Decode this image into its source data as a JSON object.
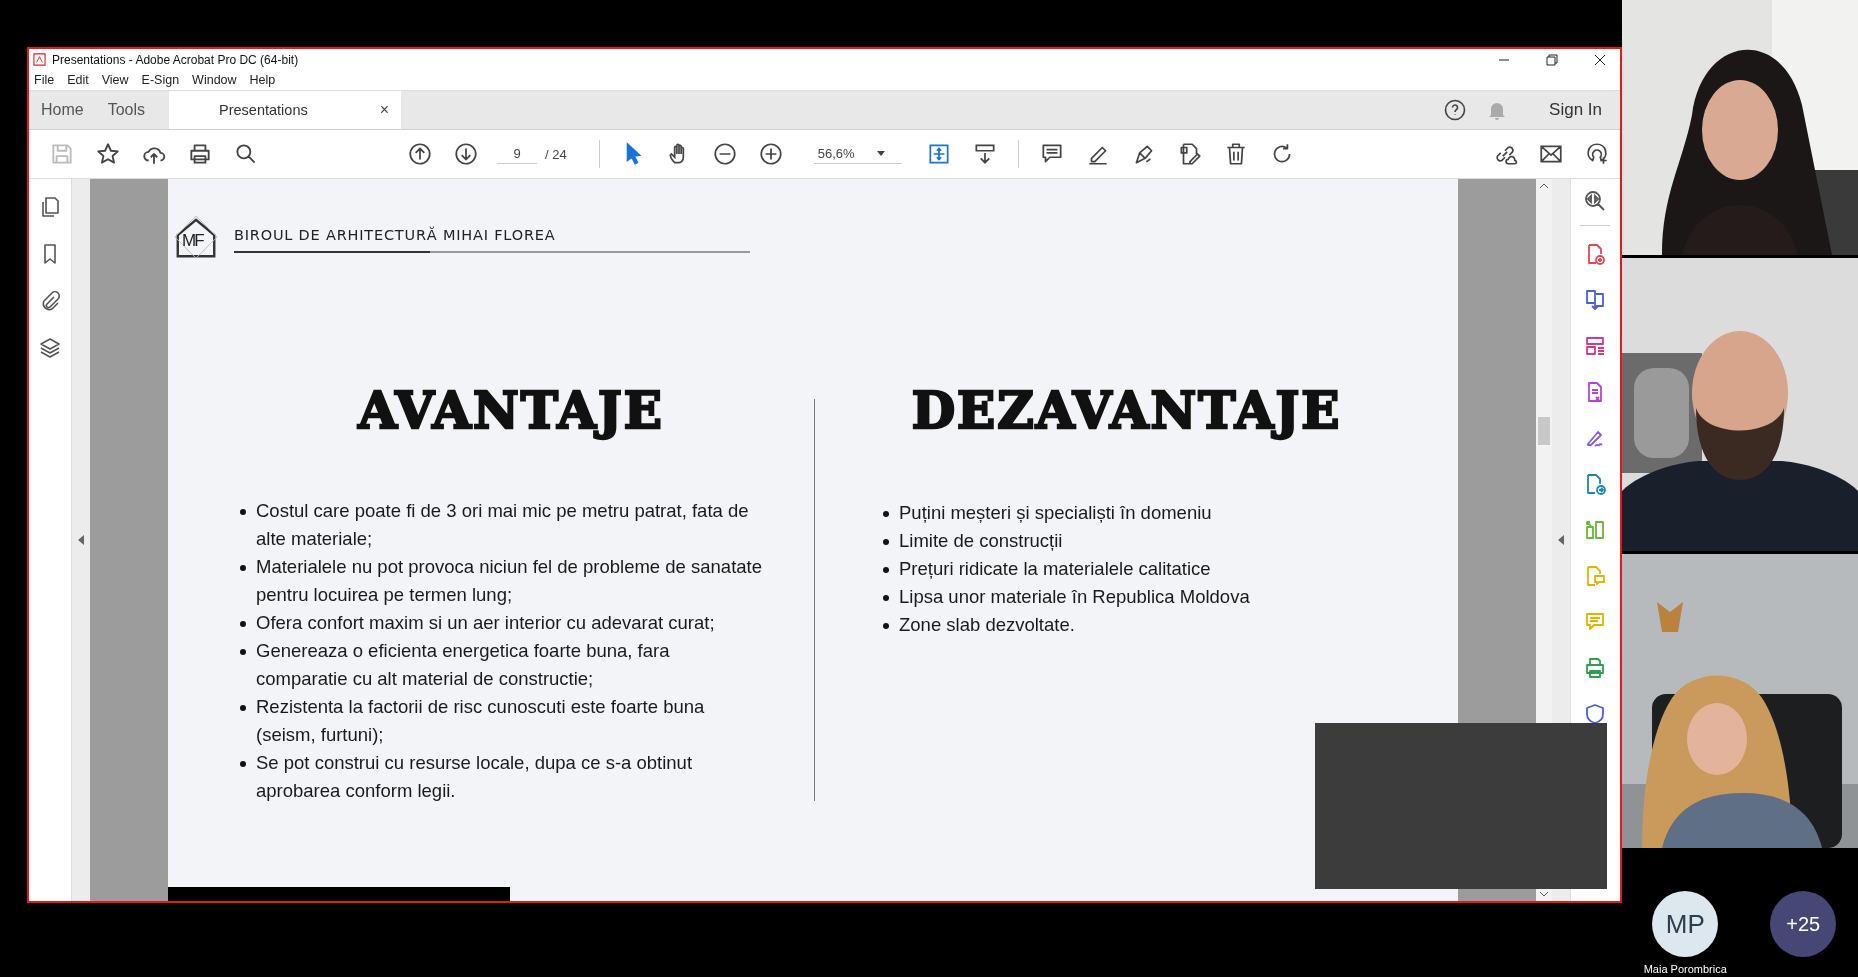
{
  "window": {
    "title": "Presentations - Adobe Acrobat Pro DC (64-bit)"
  },
  "menu": [
    "File",
    "Edit",
    "View",
    "E-Sign",
    "Window",
    "Help"
  ],
  "tabs": [
    {
      "label": "Home",
      "selected": false
    },
    {
      "label": "Tools",
      "selected": false
    },
    {
      "label": "Presentations",
      "selected": true,
      "close": "×"
    }
  ],
  "sign_in": "Sign In",
  "toolbar": {
    "page": "9",
    "page_total": "/ 24",
    "zoom": "56,6%"
  },
  "slide": {
    "logo_text": "MF",
    "brand": "BIROUL DE ARHITECTURĂ MIHAI FLOREA",
    "columns": [
      {
        "heading": "AVANTAJE",
        "items": [
          "Costul care poate fi de 3 ori mai mic pe metru patrat, fata de alte materiale;",
          "Materialele nu pot provoca niciun fel de probleme de sanatate pentru locuirea pe termen lung;",
          "Ofera confort maxim si un aer interior cu adevarat curat;",
          "Genereaza o eficienta energetica foarte buna, fara comparatie cu alt material de constructie;",
          "Rezistenta la factorii de risc cunoscuti este foarte buna (seism, furtuni);",
          "Se pot construi cu resurse locale, dupa ce s-a obtinut aprobarea conform legii."
        ]
      },
      {
        "heading": "DEZAVANTAJE",
        "items": [
          "Puțini meșteri și specialiști în domeniu",
          "Limite de construcții",
          "Prețuri ridicate la materialele calitatice",
          "Lipsa unor materiale în Republica Moldova",
          "Zone slab dezvoltate."
        ]
      }
    ]
  },
  "meeting": {
    "participant": {
      "initials": "MP",
      "name": "Maia Porombrica"
    },
    "more": "+25"
  }
}
